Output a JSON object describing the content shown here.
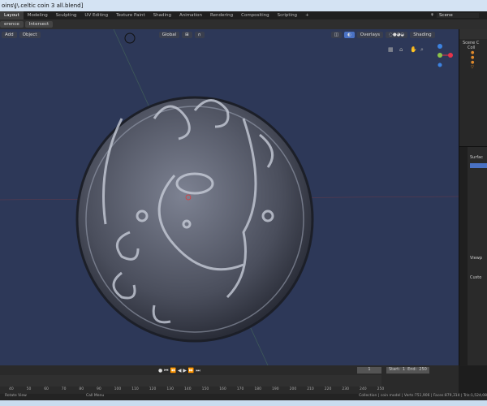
{
  "title": "oins\\J\\.celtic coin 3 all.blend]",
  "workspace_tabs": [
    "Layout",
    "Modeling",
    "Sculpting",
    "UV Editing",
    "Texture Paint",
    "Shading",
    "Animation",
    "Rendering",
    "Compositing",
    "Scripting"
  ],
  "active_tab": "Layout",
  "scene": "Scene",
  "tool_row": [
    "erence",
    "Intersect"
  ],
  "viewport_header": {
    "add": "Add",
    "object": "Object",
    "orientation": "Global",
    "overlays": "Overlays",
    "shading": "Shading"
  },
  "outliner": {
    "root": "Scene C",
    "collection": "Coll"
  },
  "properties": {
    "surface": "Surfac",
    "viewport": "Viewp",
    "custom": "Custo"
  },
  "timeline": {
    "current_frame": "1",
    "start_label": "Start:",
    "start": "1",
    "end_label": "End:",
    "end": "250",
    "ticks": [
      "40",
      "50",
      "60",
      "70",
      "80",
      "90",
      "100",
      "110",
      "120",
      "130",
      "140",
      "150",
      "160",
      "170",
      "180",
      "190",
      "200",
      "210",
      "220",
      "230",
      "240",
      "250"
    ]
  },
  "status": {
    "left": "Rotate View",
    "middle": "Call Menu",
    "right": "Collection | coin model | Verts:751,906 | Faces:879,314 | Tris:1,524,08"
  },
  "colors": {
    "viewport_bg": "#2d3858",
    "x_axis": "#e8334a",
    "y_axis": "#8bc34a",
    "z_axis": "#3c82e0"
  }
}
